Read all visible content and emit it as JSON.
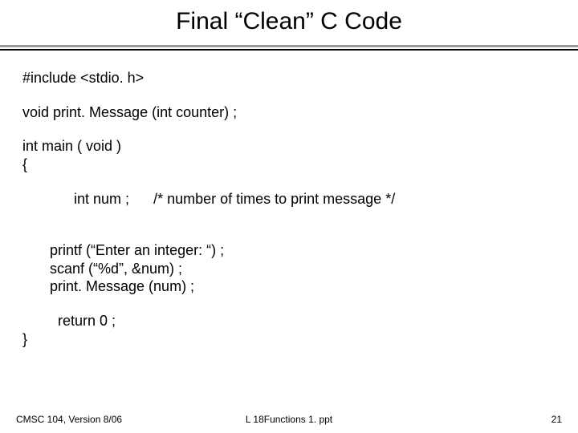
{
  "title": "Final “Clean” C Code",
  "code": {
    "l1": "#include <stdio. h>",
    "l2": "void print. Message (int counter) ;",
    "l3": "int main ( void )",
    "l4": "{",
    "l5a": "int num ;",
    "l5b": "/* number of times to print message */",
    "l6": "printf (“Enter an integer: “) ;",
    "l7": "scanf (“%d”, &num) ;",
    "l8": "print. Message (num) ;",
    "l9": "return 0 ;",
    "l10": "}"
  },
  "footer": {
    "left": "CMSC 104, Version 8/06",
    "center": "L 18Functions 1. ppt",
    "right": "21"
  }
}
